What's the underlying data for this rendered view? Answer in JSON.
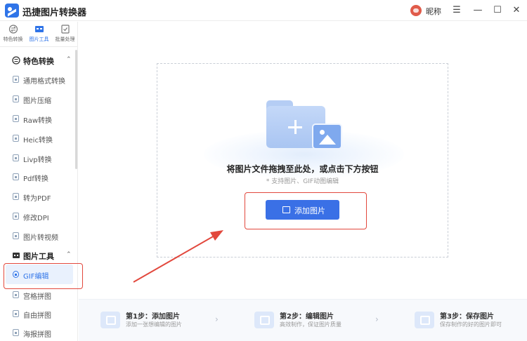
{
  "app": {
    "title": "迅捷图片转换器",
    "nickname": "昵称"
  },
  "window": {
    "menu_icon": "☰",
    "minimize_icon": "—",
    "maximize_icon": "☐",
    "close_icon": "✕"
  },
  "topnav": [
    {
      "label": "特色转换",
      "icon": "swap-icon",
      "active": false
    },
    {
      "label": "图片工具",
      "icon": "toolbox-icon",
      "active": true
    },
    {
      "label": "批量处理",
      "icon": "batch-icon",
      "active": false
    }
  ],
  "sidebar": {
    "section1": {
      "label": "特色转换",
      "chevron": "⌃"
    },
    "items1": [
      "通用格式转换",
      "图片压缩",
      "Raw转换",
      "Heic转换",
      "Livp转换",
      "Pdf转换",
      "转为PDF",
      "修改DPI",
      "图片转视频"
    ],
    "section2": {
      "label": "图片工具",
      "chevron": "⌃"
    },
    "items2": [
      "GIF编辑",
      "宫格拼图",
      "自由拼图",
      "海报拼图"
    ],
    "active_item": "GIF编辑"
  },
  "main": {
    "drop_title": "将图片文件拖拽至此处，或点击下方按钮",
    "drop_hint": "* 支持图片、GIF动图编辑",
    "add_button": "添加图片"
  },
  "steps": [
    {
      "title": "第1步：添加图片",
      "desc": "添加一张想编辑的图片"
    },
    {
      "title": "第2步：编辑图片",
      "desc": "高效制作，保证图片质量"
    },
    {
      "title": "第3步：保存图片",
      "desc": "保存制作的好的图片即可"
    }
  ],
  "colors": {
    "accent": "#3a70e6",
    "highlight": "#e2483d",
    "active_bg": "#e9f1fd"
  }
}
